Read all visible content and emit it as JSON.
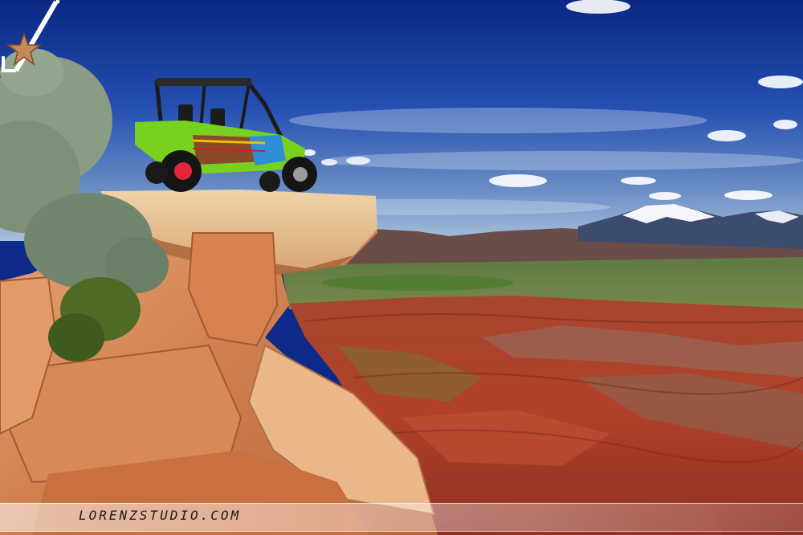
{
  "watermark": {
    "text": "LORENZSTUDIO.COM",
    "logo_icon": "star-in-box-logo-icon"
  },
  "colors": {
    "sky_top": "#0b2a86",
    "sky_horizon": "#6f92c8",
    "canyon_red": "#b8452c",
    "sandstone": "#d48a5a",
    "vehicle_green": "#79d11f",
    "snow": "#f4f6fa"
  }
}
